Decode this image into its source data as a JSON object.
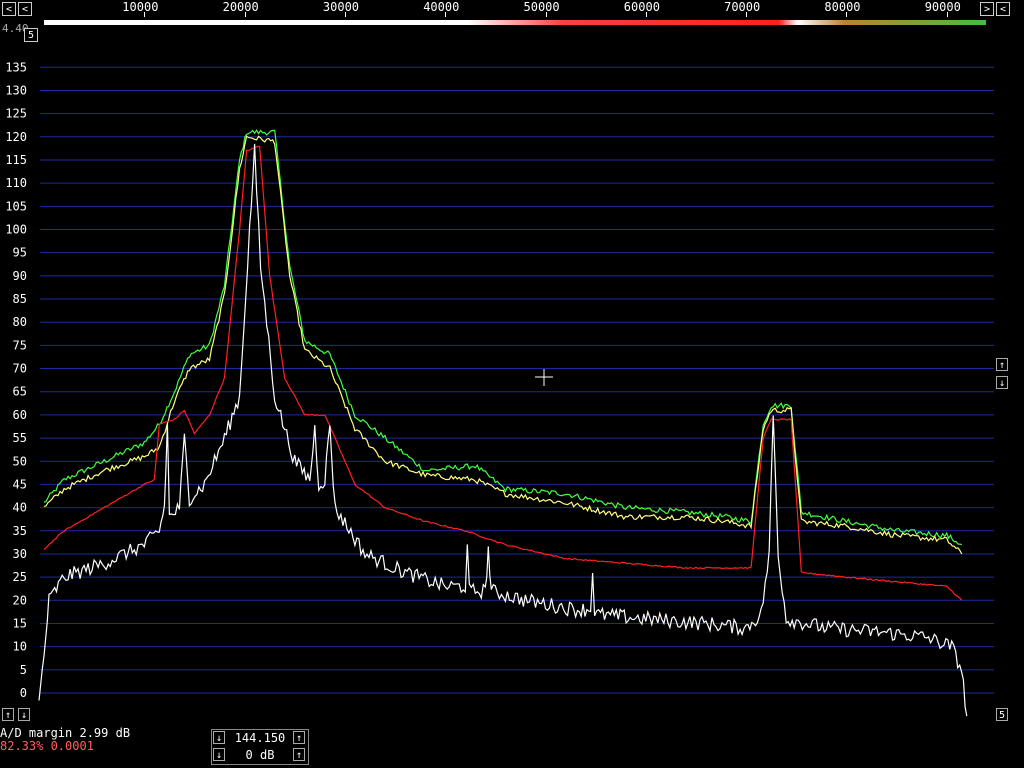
{
  "top_scale": {
    "ticks": [
      "10000",
      "20000",
      "30000",
      "40000",
      "50000",
      "60000",
      "70000",
      "80000",
      "90000"
    ],
    "left_arrow": "<",
    "right_arrow_1": ">",
    "right_arrow_2": "<"
  },
  "overlay_text": {
    "corner": "4.40",
    "corner_box": "5"
  },
  "y_axis": {
    "labels": [
      "135",
      "130",
      "125",
      "120",
      "115",
      "110",
      "105",
      "100",
      "95",
      "90",
      "85",
      "80",
      "75",
      "70",
      "65",
      "60",
      "55",
      "50",
      "45",
      "40",
      "35",
      "30",
      "25",
      "20",
      "15",
      "10",
      "5",
      "0"
    ]
  },
  "side_controls": {
    "up": "↑",
    "down": "↓",
    "bottom_right_box": "5"
  },
  "status": {
    "line1": "A/D margin  2.99 dB",
    "line2": "82.33% 0.0001"
  },
  "freq_control": {
    "frequency": "144.150",
    "gain": "0 dB"
  },
  "colors": {
    "grid": "#1c2a9e",
    "green": "#40ff40",
    "yellow": "#ffff80",
    "red": "#ff2020",
    "white": "#ffffff"
  },
  "chart_data": {
    "type": "line",
    "x_range": [
      0,
      95000
    ],
    "ylim": [
      -5,
      140
    ],
    "series": [
      {
        "key": "green",
        "points": [
          [
            0,
            41
          ],
          [
            2000,
            46
          ],
          [
            6000,
            50
          ],
          [
            10000,
            54
          ],
          [
            11500,
            58
          ],
          [
            13000,
            65
          ],
          [
            14500,
            73
          ],
          [
            16500,
            75
          ],
          [
            18000,
            88
          ],
          [
            19500,
            115
          ],
          [
            20200,
            121
          ],
          [
            23000,
            121
          ],
          [
            24500,
            92
          ],
          [
            26000,
            76
          ],
          [
            28500,
            73
          ],
          [
            31000,
            60
          ],
          [
            34000,
            55
          ],
          [
            38000,
            48
          ],
          [
            43000,
            49
          ],
          [
            46000,
            44
          ],
          [
            52000,
            43
          ],
          [
            58000,
            40
          ],
          [
            64000,
            39
          ],
          [
            68000,
            38
          ],
          [
            70500,
            37
          ],
          [
            71700,
            58
          ],
          [
            72500,
            62
          ],
          [
            74500,
            62
          ],
          [
            75500,
            39
          ],
          [
            80000,
            37
          ],
          [
            85000,
            35
          ],
          [
            90000,
            34
          ],
          [
            91500,
            32
          ]
        ]
      },
      {
        "key": "yellow",
        "points": [
          [
            0,
            40
          ],
          [
            2000,
            44
          ],
          [
            6000,
            48
          ],
          [
            10000,
            51
          ],
          [
            11500,
            53
          ],
          [
            13000,
            63
          ],
          [
            14500,
            70
          ],
          [
            16500,
            72
          ],
          [
            18000,
            86
          ],
          [
            19500,
            113
          ],
          [
            20200,
            120
          ],
          [
            23000,
            119
          ],
          [
            24500,
            90
          ],
          [
            26000,
            74
          ],
          [
            28500,
            70
          ],
          [
            31000,
            57
          ],
          [
            34000,
            50
          ],
          [
            38000,
            47
          ],
          [
            43000,
            46
          ],
          [
            46000,
            43
          ],
          [
            52000,
            41
          ],
          [
            58000,
            38
          ],
          [
            64000,
            38
          ],
          [
            68000,
            37
          ],
          [
            70500,
            36
          ],
          [
            71700,
            57
          ],
          [
            72500,
            61
          ],
          [
            74500,
            61
          ],
          [
            75500,
            37
          ],
          [
            80000,
            36
          ],
          [
            85000,
            34
          ],
          [
            90000,
            33
          ],
          [
            91500,
            30
          ]
        ]
      },
      {
        "key": "red",
        "points": [
          [
            0,
            31
          ],
          [
            2000,
            35
          ],
          [
            6000,
            40
          ],
          [
            10000,
            45
          ],
          [
            11000,
            46
          ],
          [
            11500,
            58
          ],
          [
            13000,
            59
          ],
          [
            14000,
            61
          ],
          [
            15000,
            56
          ],
          [
            16500,
            60
          ],
          [
            18000,
            68
          ],
          [
            19500,
            100
          ],
          [
            20200,
            117
          ],
          [
            21500,
            118
          ],
          [
            22500,
            90
          ],
          [
            24000,
            68
          ],
          [
            26000,
            60
          ],
          [
            28000,
            60
          ],
          [
            29000,
            55
          ],
          [
            31000,
            45
          ],
          [
            34000,
            40
          ],
          [
            38000,
            37
          ],
          [
            42000,
            35
          ],
          [
            46000,
            32
          ],
          [
            52000,
            29
          ],
          [
            58000,
            28
          ],
          [
            64000,
            27
          ],
          [
            68000,
            27
          ],
          [
            70500,
            27
          ],
          [
            71700,
            55
          ],
          [
            72500,
            59
          ],
          [
            74500,
            59
          ],
          [
            75500,
            26
          ],
          [
            80000,
            25
          ],
          [
            85000,
            24
          ],
          [
            90000,
            23
          ],
          [
            91500,
            20
          ]
        ]
      },
      {
        "key": "white",
        "points": [
          [
            -500,
            -2
          ],
          [
            0,
            8
          ],
          [
            500,
            20
          ],
          [
            2000,
            25
          ],
          [
            6000,
            28
          ],
          [
            10000,
            32
          ],
          [
            11500,
            35
          ],
          [
            12000,
            40
          ],
          [
            12300,
            58
          ],
          [
            12500,
            38
          ],
          [
            13500,
            40
          ],
          [
            14000,
            55
          ],
          [
            14500,
            42
          ],
          [
            16000,
            45
          ],
          [
            18000,
            55
          ],
          [
            19500,
            64
          ],
          [
            20500,
            100
          ],
          [
            21000,
            117
          ],
          [
            21600,
            92
          ],
          [
            23000,
            64
          ],
          [
            25000,
            50
          ],
          [
            26500,
            46
          ],
          [
            27000,
            57
          ],
          [
            27400,
            45
          ],
          [
            28000,
            46
          ],
          [
            28500,
            58
          ],
          [
            29000,
            40
          ],
          [
            32000,
            30
          ],
          [
            36000,
            26
          ],
          [
            40000,
            23
          ],
          [
            42000,
            23
          ],
          [
            42200,
            31
          ],
          [
            42400,
            22
          ],
          [
            44000,
            22
          ],
          [
            44300,
            31
          ],
          [
            44600,
            22
          ],
          [
            48000,
            20
          ],
          [
            53000,
            18
          ],
          [
            54500,
            18
          ],
          [
            54700,
            27
          ],
          [
            54900,
            17
          ],
          [
            60000,
            16
          ],
          [
            66000,
            15
          ],
          [
            70000,
            14
          ],
          [
            71500,
            17
          ],
          [
            72300,
            30
          ],
          [
            72700,
            60
          ],
          [
            73200,
            30
          ],
          [
            74000,
            16
          ],
          [
            78000,
            14
          ],
          [
            84000,
            13
          ],
          [
            88000,
            12
          ],
          [
            90500,
            10
          ],
          [
            91500,
            5
          ],
          [
            92000,
            -5
          ]
        ]
      }
    ]
  }
}
